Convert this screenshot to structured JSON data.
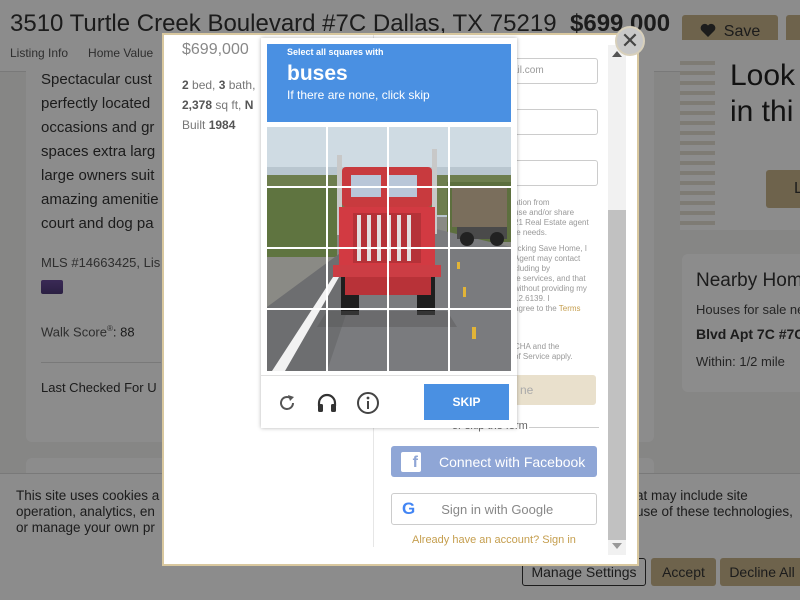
{
  "listing": {
    "address": "3510 Turtle Creek Boulevard #7C Dallas, TX 75219",
    "price": "$699,000",
    "nav": [
      "Listing Info",
      "Home Value"
    ],
    "save_label": "Save",
    "description": "Spectacular cust\nperfectly located\noccasions and gr\nspaces extra larg\nlarge owners suit\namazing amenitie\ncourt and dog pa",
    "mls": "MLS #14663425, Lis",
    "walk_score_label": "Walk Score",
    "walk_score_sup": "®",
    "walk_score_value": ": 88",
    "last_checked": "Last Checked For U",
    "beds": "2",
    "beds_label": " bed, ",
    "baths": "3",
    "baths_label": " bath, ",
    "sqft": "2,378",
    "sqft_label": " sq ft, ",
    "sqft_extra": "N",
    "built_label": "Built ",
    "built_year": "1984"
  },
  "promo": {
    "heading_1": "Look",
    "heading_2": "in thi",
    "button_label": "L"
  },
  "nearby": {
    "title": "Nearby Hom",
    "subtitle": "Houses for sale ne",
    "item": "Blvd Apt 7C #7C",
    "within": "Within: 1/2 mile"
  },
  "cookie": {
    "text": "This site uses cookies a                                                                                                                                  at may include site operation, analytics, en                                                                                                                           use of these technologies, or manage your own pr",
    "manage_label": "Manage Settings",
    "accept_label": "Accept",
    "decline_label": "Decline All"
  },
  "modal": {
    "email_placeholder": "ail.com",
    "legal_1": "ation from",
    "legal_2": "use and/or share",
    "legal_3": "21 Real Estate agent",
    "legal_4": "te needs.",
    "legal_5": "licking Save Home, I",
    "legal_6": "Agent may contact",
    "legal_7": "cluding by",
    "legal_8": "te services, and that",
    "legal_9": "without providing my",
    "legal_10": "12.6139. I",
    "legal_11": "agree to the Terms",
    "legal_12": "CHA and the",
    "legal_13": "of Service apply.",
    "legal_link_terms": "Terms",
    "legal_link_service": "Service",
    "save_home_label": "ne",
    "skip_form_label": "or skip the form",
    "facebook_label": "Connect with Facebook",
    "google_label": "Sign in with Google",
    "signin_label": "Already have an account? Sign in"
  },
  "captcha": {
    "instruction": "Select all squares with",
    "target": "buses",
    "hint": "If there are none, click skip",
    "skip_label": "SKIP"
  },
  "icons": {
    "close": "close-icon",
    "reload": "reload-icon",
    "audio": "headphones-icon",
    "info": "info-icon",
    "heart": "heart-icon",
    "facebook": "facebook-icon",
    "google": "google-icon"
  },
  "colors": {
    "brand_gold": "#c8b48a",
    "captcha_blue": "#4a90e2",
    "facebook_blue": "#8fa6d6",
    "link_gold": "#c59e4e"
  }
}
